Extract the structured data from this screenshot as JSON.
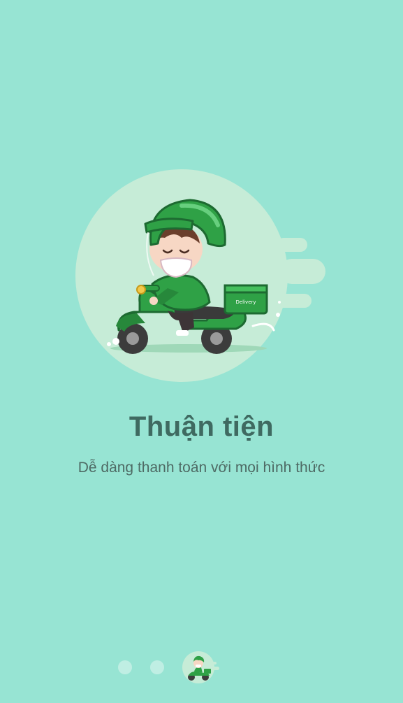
{
  "onboarding": {
    "title": "Thuận tiện",
    "subtitle": "Dễ dàng thanh toán với mọi hình thức",
    "illustration": {
      "icon": "scooter-delivery-rider-icon",
      "box_label": "Delivery"
    },
    "pager": {
      "total": 3,
      "active_index": 3
    }
  },
  "colors": {
    "background": "#97e4d3",
    "title": "#3f6a61",
    "subtitle": "#4e6a64",
    "circle": "#c6ecd7",
    "green": "#2fa146",
    "dot_inactive": "#bfeee3"
  }
}
